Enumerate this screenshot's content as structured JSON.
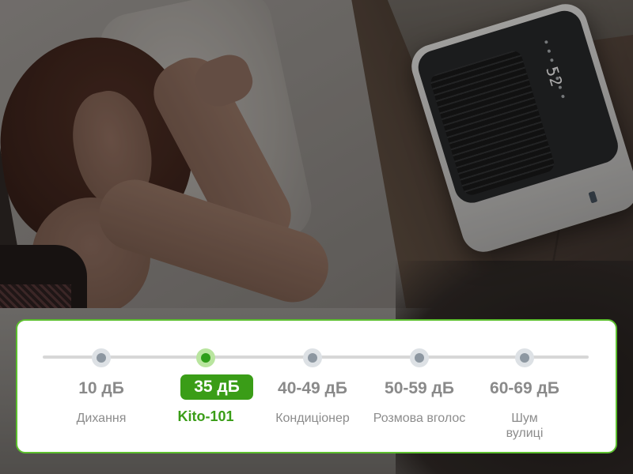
{
  "device": {
    "display_value": "52"
  },
  "noise_scale": {
    "stops": [
      {
        "level": "10 дБ",
        "description": "Дихання",
        "active": false
      },
      {
        "level": "35 дБ",
        "description": "Kito-101",
        "active": true
      },
      {
        "level": "40-49 дБ",
        "description": "Кондиціонер",
        "active": false
      },
      {
        "level": "50-59 дБ",
        "description": "Розмова вголос",
        "active": false
      },
      {
        "level": "60-69 дБ",
        "description": "Шум вулиці",
        "active": false
      }
    ],
    "colors": {
      "accent": "#3a9d17",
      "border": "#5cbf2e",
      "inactive_text": "#8a8a8a",
      "inactive_dot": "#8d97a1",
      "track": "#d7d7d7"
    }
  }
}
